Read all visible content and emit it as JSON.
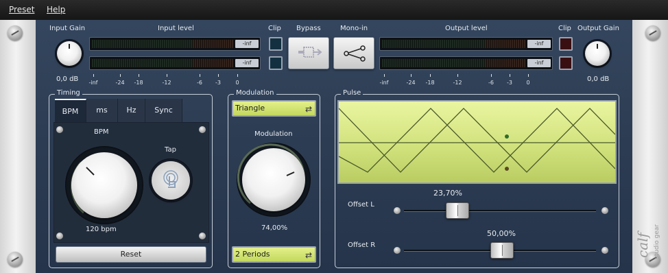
{
  "menu": {
    "preset": "Preset",
    "help": "Help"
  },
  "header": {
    "input_gain_label": "Input Gain",
    "input_gain_value": "0,0 dB",
    "input_level_label": "Input level",
    "clip_label": "Clip",
    "bypass_label": "Bypass",
    "mono_in_label": "Mono-in",
    "output_level_label": "Output level",
    "output_gain_label": "Output Gain",
    "output_gain_value": "0,0 dB",
    "meter_value": "-inf",
    "scale": [
      "-inf",
      "-24",
      "-18",
      "-12",
      "-6",
      "-3",
      "0"
    ]
  },
  "timing": {
    "title": "Timing",
    "tabs": [
      "BPM",
      "ms",
      "Hz",
      "Sync"
    ],
    "active_tab": "BPM",
    "bpm_label": "BPM",
    "bpm_value": "120 bpm",
    "tap_label": "Tap",
    "reset_label": "Reset"
  },
  "modulation": {
    "title": "Modulation",
    "waveform": "Triangle",
    "knob_label": "Modulation",
    "knob_value": "74,00%",
    "periods": "2 Periods"
  },
  "pulse": {
    "title": "Pulse",
    "offset_l_label": "Offset L",
    "offset_l_value": "23,70%",
    "offset_l_fraction": 0.237,
    "offset_r_label": "Offset R",
    "offset_r_value": "50,00%",
    "offset_r_fraction": 0.5
  },
  "colors": {
    "panel": "#2f4058",
    "lcd": "#d8e88a",
    "wave": "#3c4a26"
  }
}
